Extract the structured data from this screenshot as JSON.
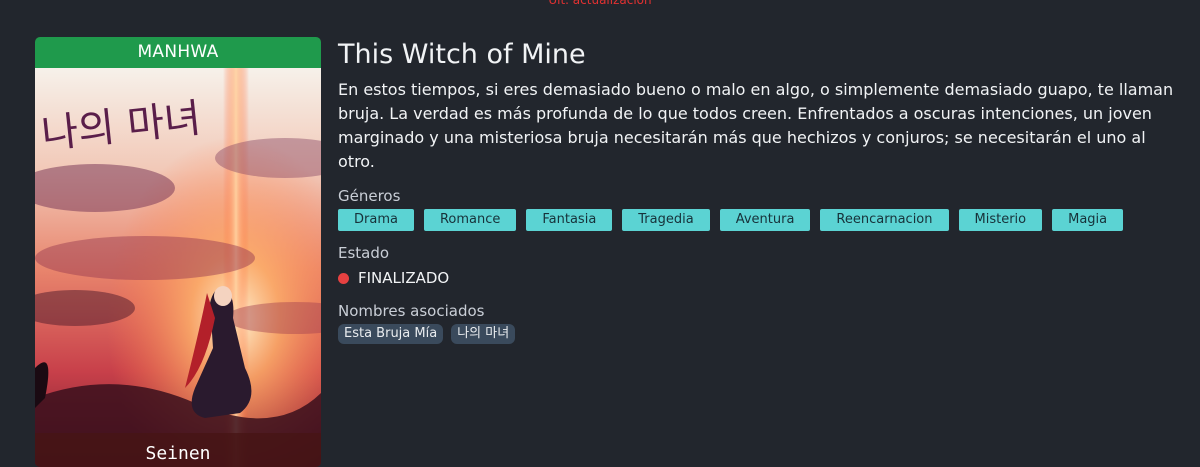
{
  "top_notice": "Ult. actualización",
  "cover": {
    "type_badge": "MANHWA",
    "title_art_text": "나의 마녀",
    "demography": "Seinen"
  },
  "manga": {
    "title": "This Witch of Mine",
    "synopsis": "En estos tiempos, si eres demasiado bueno o malo en algo, o simplemente demasiado guapo, te llaman bruja. La verdad es más profunda de lo que todos creen. Enfrentados a oscuras intenciones, un joven marginado y una misteriosa bruja necesitarán más que hechizos y conjuros; se necesitarán el uno al otro."
  },
  "genres": {
    "label": "Géneros",
    "items": [
      "Drama",
      "Romance",
      "Fantasia",
      "Tragedia",
      "Aventura",
      "Reencarnacion",
      "Misterio",
      "Magia"
    ]
  },
  "status": {
    "label": "Estado",
    "value": "FINALIZADO",
    "color": "#e74141"
  },
  "alt_names": {
    "label": "Nombres asociados",
    "items": [
      "Esta Bruja Mía",
      "나의 마녀"
    ]
  },
  "colors": {
    "background": "#22262d",
    "badge_green": "#1f9a4c",
    "genre_tag": "#5bd3d3",
    "alt_tag": "#3a4a5c"
  }
}
